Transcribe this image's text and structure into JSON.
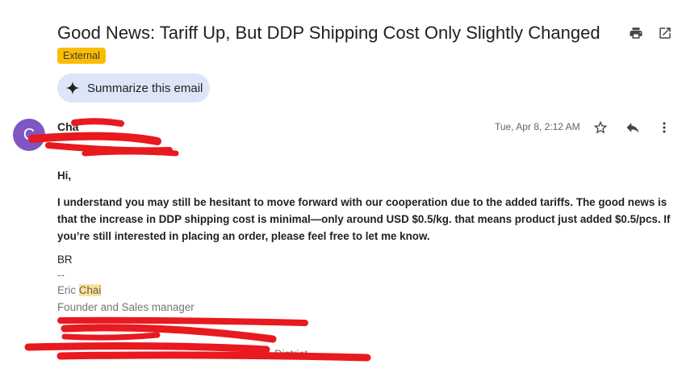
{
  "email": {
    "subject": "Good News: Tariff Up, But DDP Shipping Cost Only Slightly Changed",
    "label": "External",
    "summarize_label": "Summarize this email",
    "sender": {
      "initial": "C",
      "name_visible": "Cha"
    },
    "date": "Tue, Apr 8, 2:12 AM",
    "body": {
      "greeting": "Hi,",
      "paragraph": "I understand you may still be hesitant to move forward with our cooperation due to the added tariffs. The good news is that the increase in DDP shipping cost is minimal—only around USD $0.5/kg. that means product just added $0.5/pcs. If you’re still interested in placing an order, please feel free to let me know."
    },
    "signature": {
      "closing": "BR",
      "dashes": "--",
      "first_name": "Eric",
      "last_name": "Chai",
      "title": "Founder and Sales manager",
      "partial_text": "District"
    }
  },
  "icons": {
    "print": "print-icon",
    "open_new_window": "open-in-new-icon",
    "sparkle": "sparkle-icon",
    "star": "star-icon",
    "reply": "reply-icon",
    "more": "more-vert-icon"
  },
  "colors": {
    "badge": "#fbbc04",
    "summarize_bg": "#dde6f8",
    "avatar": "#7e57c2",
    "highlight": "#fde293",
    "redaction": "#e8191f"
  }
}
